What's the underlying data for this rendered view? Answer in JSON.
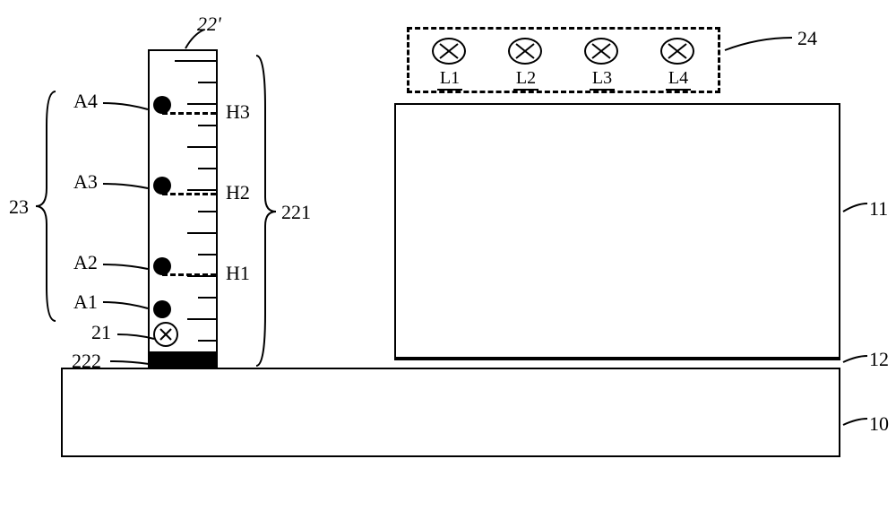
{
  "refs": {
    "base": "10",
    "platform_top": "11",
    "platform_line": "12",
    "float": "21",
    "column_ref": "22'",
    "column_inner": "222",
    "column_scale_ref": "221",
    "sensor_group": "23",
    "light_group": "24"
  },
  "sensors": {
    "a1": "A1",
    "a2": "A2",
    "a3": "A3",
    "a4": "A4"
  },
  "heights": {
    "h1": "H1",
    "h2": "H2",
    "h3": "H3"
  },
  "lights": {
    "l1": "L1",
    "l2": "L2",
    "l3": "L3",
    "l4": "L4"
  },
  "chart_data": {
    "type": "diagram",
    "description": "Technical schematic of a liquid level measurement device with sensor column and indicator lights",
    "components": [
      {
        "ref": "10",
        "name": "base"
      },
      {
        "ref": "11",
        "name": "upper-container"
      },
      {
        "ref": "12",
        "name": "separator-line"
      },
      {
        "ref": "21",
        "name": "float-ball"
      },
      {
        "ref": "22'",
        "name": "measurement-column"
      },
      {
        "ref": "221",
        "name": "scale-region"
      },
      {
        "ref": "222",
        "name": "column-base-block"
      },
      {
        "ref": "23",
        "name": "sensor-group"
      },
      {
        "ref": "24",
        "name": "indicator-light-panel"
      }
    ],
    "sensors": [
      "A1",
      "A2",
      "A3",
      "A4"
    ],
    "height_marks": [
      "H1",
      "H2",
      "H3"
    ],
    "lights": [
      "L1",
      "L2",
      "L3",
      "L4"
    ]
  }
}
